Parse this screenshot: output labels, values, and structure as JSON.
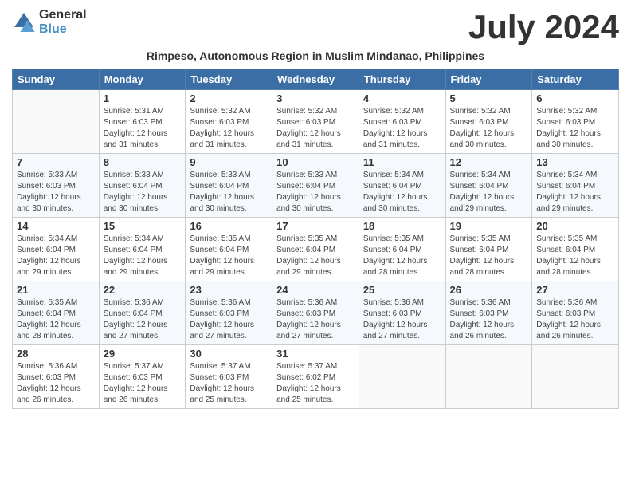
{
  "header": {
    "logo_general": "General",
    "logo_blue": "Blue",
    "month_title": "July 2024",
    "subtitle": "Rimpeso, Autonomous Region in Muslim Mindanao, Philippines"
  },
  "calendar": {
    "days_of_week": [
      "Sunday",
      "Monday",
      "Tuesday",
      "Wednesday",
      "Thursday",
      "Friday",
      "Saturday"
    ],
    "weeks": [
      [
        {
          "day": "",
          "info": ""
        },
        {
          "day": "1",
          "info": "Sunrise: 5:31 AM\nSunset: 6:03 PM\nDaylight: 12 hours\nand 31 minutes."
        },
        {
          "day": "2",
          "info": "Sunrise: 5:32 AM\nSunset: 6:03 PM\nDaylight: 12 hours\nand 31 minutes."
        },
        {
          "day": "3",
          "info": "Sunrise: 5:32 AM\nSunset: 6:03 PM\nDaylight: 12 hours\nand 31 minutes."
        },
        {
          "day": "4",
          "info": "Sunrise: 5:32 AM\nSunset: 6:03 PM\nDaylight: 12 hours\nand 31 minutes."
        },
        {
          "day": "5",
          "info": "Sunrise: 5:32 AM\nSunset: 6:03 PM\nDaylight: 12 hours\nand 30 minutes."
        },
        {
          "day": "6",
          "info": "Sunrise: 5:32 AM\nSunset: 6:03 PM\nDaylight: 12 hours\nand 30 minutes."
        }
      ],
      [
        {
          "day": "7",
          "info": "Sunrise: 5:33 AM\nSunset: 6:03 PM\nDaylight: 12 hours\nand 30 minutes."
        },
        {
          "day": "8",
          "info": "Sunrise: 5:33 AM\nSunset: 6:04 PM\nDaylight: 12 hours\nand 30 minutes."
        },
        {
          "day": "9",
          "info": "Sunrise: 5:33 AM\nSunset: 6:04 PM\nDaylight: 12 hours\nand 30 minutes."
        },
        {
          "day": "10",
          "info": "Sunrise: 5:33 AM\nSunset: 6:04 PM\nDaylight: 12 hours\nand 30 minutes."
        },
        {
          "day": "11",
          "info": "Sunrise: 5:34 AM\nSunset: 6:04 PM\nDaylight: 12 hours\nand 30 minutes."
        },
        {
          "day": "12",
          "info": "Sunrise: 5:34 AM\nSunset: 6:04 PM\nDaylight: 12 hours\nand 29 minutes."
        },
        {
          "day": "13",
          "info": "Sunrise: 5:34 AM\nSunset: 6:04 PM\nDaylight: 12 hours\nand 29 minutes."
        }
      ],
      [
        {
          "day": "14",
          "info": "Sunrise: 5:34 AM\nSunset: 6:04 PM\nDaylight: 12 hours\nand 29 minutes."
        },
        {
          "day": "15",
          "info": "Sunrise: 5:34 AM\nSunset: 6:04 PM\nDaylight: 12 hours\nand 29 minutes."
        },
        {
          "day": "16",
          "info": "Sunrise: 5:35 AM\nSunset: 6:04 PM\nDaylight: 12 hours\nand 29 minutes."
        },
        {
          "day": "17",
          "info": "Sunrise: 5:35 AM\nSunset: 6:04 PM\nDaylight: 12 hours\nand 29 minutes."
        },
        {
          "day": "18",
          "info": "Sunrise: 5:35 AM\nSunset: 6:04 PM\nDaylight: 12 hours\nand 28 minutes."
        },
        {
          "day": "19",
          "info": "Sunrise: 5:35 AM\nSunset: 6:04 PM\nDaylight: 12 hours\nand 28 minutes."
        },
        {
          "day": "20",
          "info": "Sunrise: 5:35 AM\nSunset: 6:04 PM\nDaylight: 12 hours\nand 28 minutes."
        }
      ],
      [
        {
          "day": "21",
          "info": "Sunrise: 5:35 AM\nSunset: 6:04 PM\nDaylight: 12 hours\nand 28 minutes."
        },
        {
          "day": "22",
          "info": "Sunrise: 5:36 AM\nSunset: 6:04 PM\nDaylight: 12 hours\nand 27 minutes."
        },
        {
          "day": "23",
          "info": "Sunrise: 5:36 AM\nSunset: 6:03 PM\nDaylight: 12 hours\nand 27 minutes."
        },
        {
          "day": "24",
          "info": "Sunrise: 5:36 AM\nSunset: 6:03 PM\nDaylight: 12 hours\nand 27 minutes."
        },
        {
          "day": "25",
          "info": "Sunrise: 5:36 AM\nSunset: 6:03 PM\nDaylight: 12 hours\nand 27 minutes."
        },
        {
          "day": "26",
          "info": "Sunrise: 5:36 AM\nSunset: 6:03 PM\nDaylight: 12 hours\nand 26 minutes."
        },
        {
          "day": "27",
          "info": "Sunrise: 5:36 AM\nSunset: 6:03 PM\nDaylight: 12 hours\nand 26 minutes."
        }
      ],
      [
        {
          "day": "28",
          "info": "Sunrise: 5:36 AM\nSunset: 6:03 PM\nDaylight: 12 hours\nand 26 minutes."
        },
        {
          "day": "29",
          "info": "Sunrise: 5:37 AM\nSunset: 6:03 PM\nDaylight: 12 hours\nand 26 minutes."
        },
        {
          "day": "30",
          "info": "Sunrise: 5:37 AM\nSunset: 6:03 PM\nDaylight: 12 hours\nand 25 minutes."
        },
        {
          "day": "31",
          "info": "Sunrise: 5:37 AM\nSunset: 6:02 PM\nDaylight: 12 hours\nand 25 minutes."
        },
        {
          "day": "",
          "info": ""
        },
        {
          "day": "",
          "info": ""
        },
        {
          "day": "",
          "info": ""
        }
      ]
    ]
  }
}
